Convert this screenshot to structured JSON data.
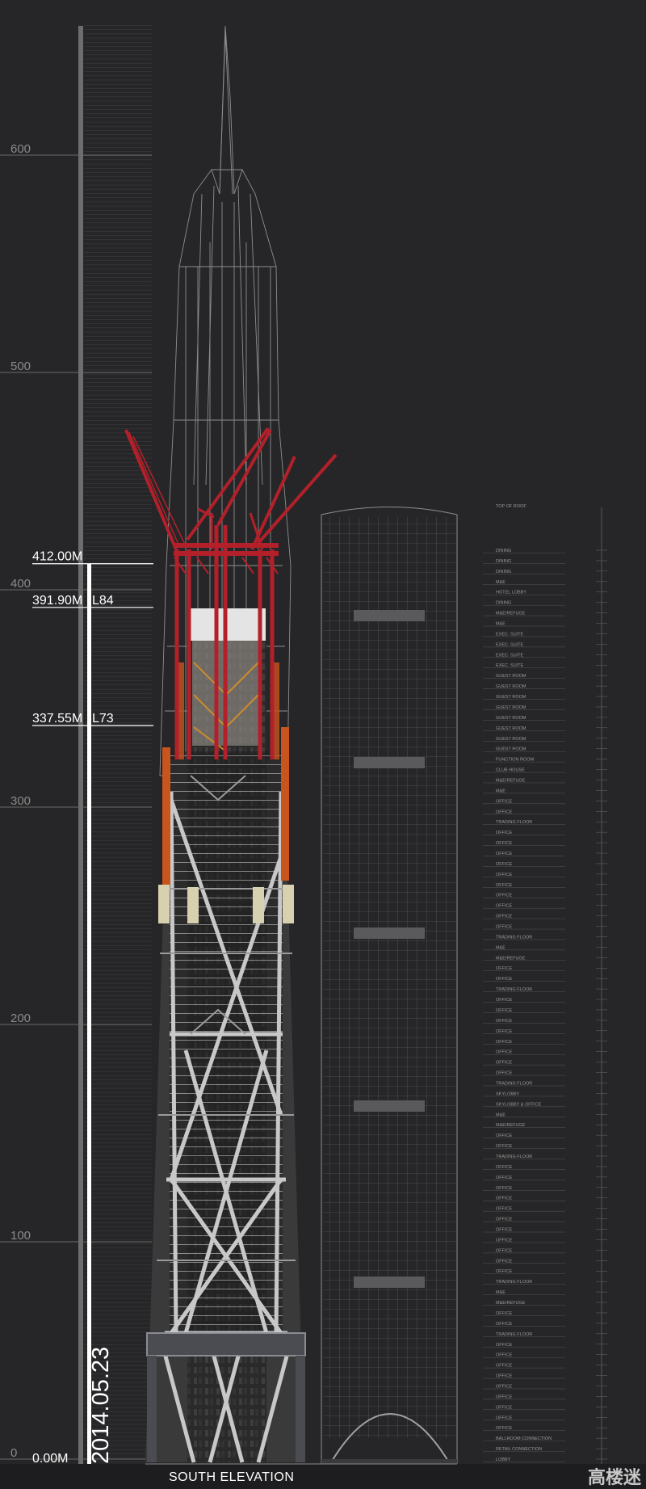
{
  "scale": {
    "ticks": [
      {
        "label": "600",
        "value": 600
      },
      {
        "label": "500",
        "value": 500
      },
      {
        "label": "400",
        "value": 400
      },
      {
        "label": "300",
        "value": 300
      },
      {
        "label": "200",
        "value": 200
      },
      {
        "label": "100",
        "value": 100
      },
      {
        "label": "0",
        "value": 0
      }
    ]
  },
  "levels": [
    {
      "label": "412.00M",
      "value": 412.0
    },
    {
      "label": "391.90M",
      "floor": "L84",
      "value": 391.9
    },
    {
      "label": "337.55M",
      "floor": "L73",
      "value": 337.55
    },
    {
      "label": "0.00M",
      "value": 0
    }
  ],
  "progress": {
    "date": "2014.05.23",
    "height_m": 412.0
  },
  "caption": "SOUTH ELEVATION",
  "floor_schedule": {
    "top_label": "TOP OF ROOF",
    "rows": [
      "DINING",
      "DINING",
      "DINING",
      "M&E",
      "HOTEL LOBBY",
      "DINING",
      "M&E/REFUGE",
      "M&E",
      "EXEC. SUITE",
      "EXEC. SUITE",
      "EXEC. SUITE",
      "EXEC. SUITE",
      "GUEST ROOM",
      "GUEST ROOM",
      "GUEST ROOM",
      "GUEST ROOM",
      "GUEST ROOM",
      "GUEST ROOM",
      "GUEST ROOM",
      "GUEST ROOM",
      "FUNCTION ROOM",
      "CLUB HOUSE",
      "M&E/REFUGE",
      "M&E",
      "OFFICE",
      "OFFICE",
      "TRADING FLOOR",
      "OFFICE",
      "OFFICE",
      "OFFICE",
      "OFFICE",
      "OFFICE",
      "OFFICE",
      "OFFICE",
      "OFFICE",
      "OFFICE",
      "OFFICE",
      "TRADING FLOOR",
      "M&E",
      "M&E/REFUGE",
      "OFFICE",
      "OFFICE",
      "TRADING FLOOR",
      "OFFICE",
      "OFFICE",
      "OFFICE",
      "OFFICE",
      "OFFICE",
      "OFFICE",
      "OFFICE",
      "OFFICE",
      "TRADING FLOOR",
      "SKYLOBBY",
      "SKYLOBBY & OFFICE",
      "M&E",
      "M&E/REFUGE",
      "OFFICE",
      "OFFICE",
      "TRADING FLOOR",
      "OFFICE",
      "OFFICE",
      "OFFICE",
      "OFFICE",
      "OFFICE",
      "OFFICE",
      "OFFICE",
      "OFFICE",
      "OFFICE",
      "OFFICE",
      "OFFICE",
      "TRADING FLOOR",
      "M&E",
      "M&E/REFUGE",
      "OFFICE",
      "OFFICE",
      "TRADING FLOOR",
      "OFFICE",
      "OFFICE",
      "OFFICE",
      "OFFICE",
      "OFFICE",
      "OFFICE",
      "OFFICE",
      "OFFICE",
      "OFFICE",
      "BALLROOM CONNECTION",
      "RETAIL CONNECTION",
      "LOBBY"
    ]
  },
  "watermark": "高楼迷",
  "colors": {
    "background": "#262628",
    "crane": "#b3202a",
    "steel": "#b9b9b9",
    "jump_form": "#c9541e",
    "scale_bar": "#6d6d6d"
  }
}
